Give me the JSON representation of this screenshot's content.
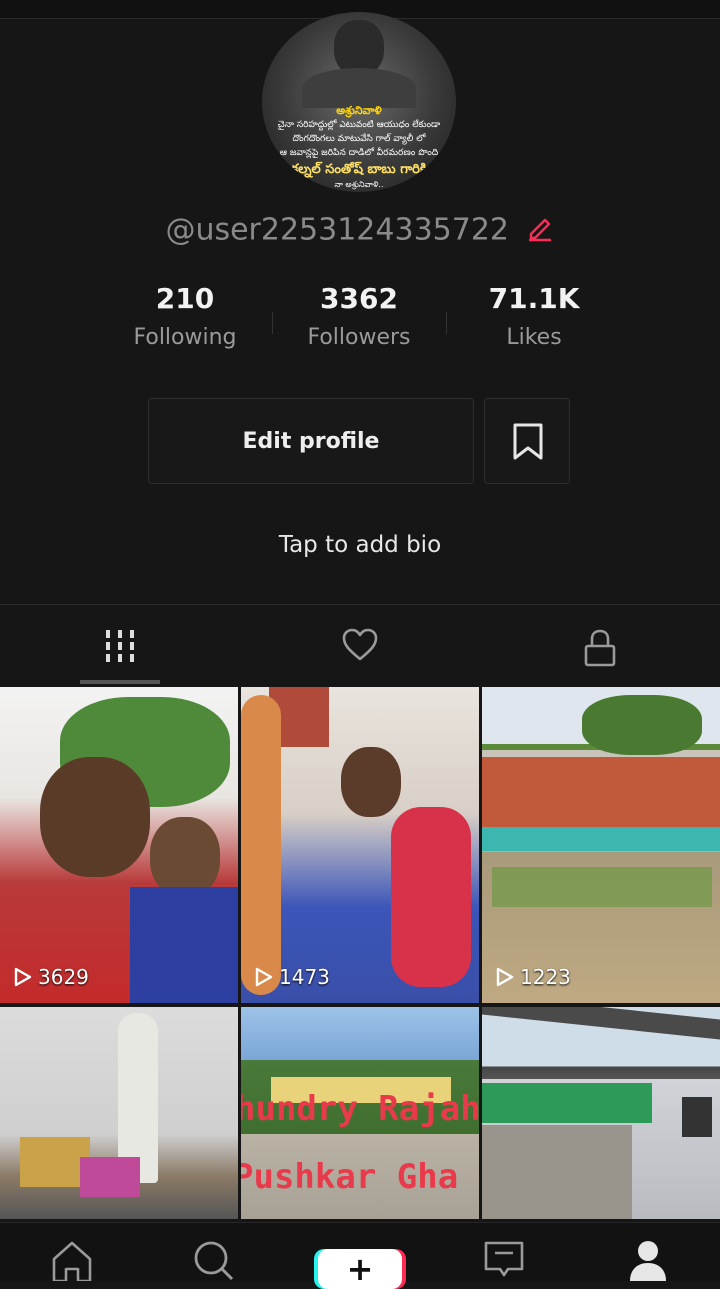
{
  "profile": {
    "avatar_lines": [
      "అశ్రునివాళి",
      "చైనా సరిహద్దుల్లో ఎటువంటి ఆయుధం లేకుండా",
      "దొంగదొంగలు మాటువేసి గాల్ వ్యాలీ లో",
      "ఆ జవాన్లపై జరిపిన దాడిలో వీరమరణం పొంది",
      "కల్నల్ సంతోష్ బాబు గారికి",
      "నా అశ్రునివాళి.."
    ],
    "username": "@user2253124335722",
    "edit_icon": "pencil-icon",
    "accent_color": "#fe2c55"
  },
  "stats": [
    {
      "value": "210",
      "label": "Following"
    },
    {
      "value": "3362",
      "label": "Followers"
    },
    {
      "value": "71.1K",
      "label": "Likes"
    }
  ],
  "actions": {
    "edit_profile_label": "Edit profile",
    "bookmark_icon": "bookmark-icon"
  },
  "bio_placeholder": "Tap to add bio",
  "tabs": [
    {
      "icon": "grid-icon",
      "selected": true
    },
    {
      "icon": "heart-icon",
      "selected": false
    },
    {
      "icon": "lock-icon",
      "selected": false
    }
  ],
  "videos": [
    {
      "views": "3629"
    },
    {
      "views": "1473"
    },
    {
      "views": "1223"
    },
    {
      "views": ""
    },
    {
      "views": "",
      "overlay_line1": "hundry Rajah",
      "overlay_line2": "Pushkar Gha"
    },
    {
      "views": ""
    }
  ],
  "bottom_nav": [
    "home-icon",
    "search-icon",
    "create-plus-icon",
    "inbox-icon",
    "profile-icon"
  ]
}
